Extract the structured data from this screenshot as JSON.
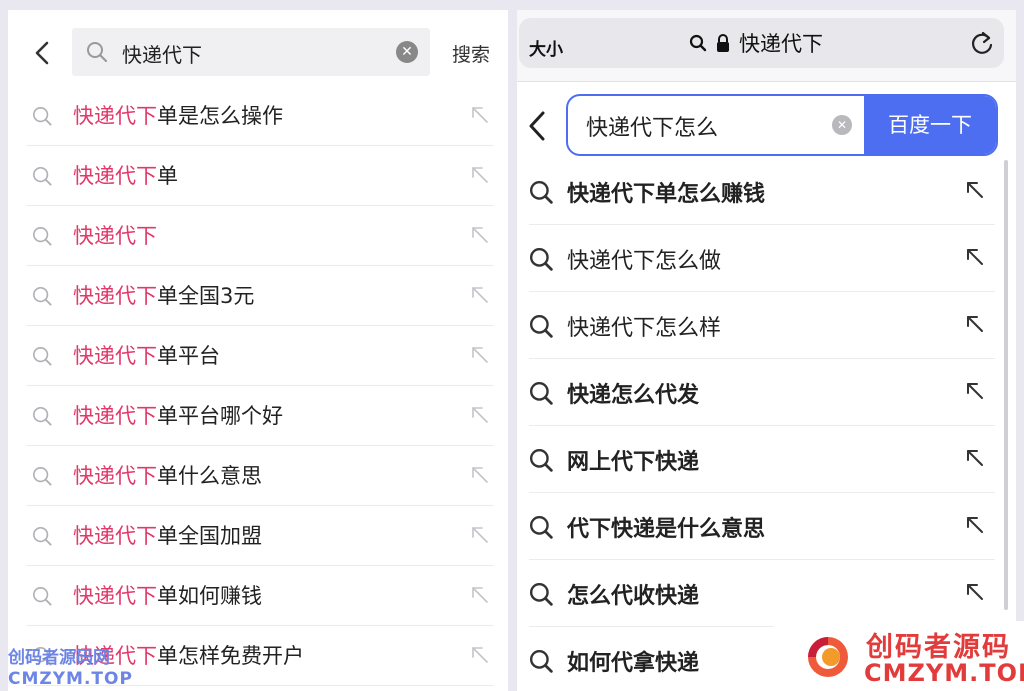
{
  "left": {
    "query": "快递代下",
    "search_button": "搜索",
    "suggestions": [
      {
        "hl": "快递代下",
        "rest": "单是怎么操作"
      },
      {
        "hl": "快递代下",
        "rest": "单"
      },
      {
        "hl": "快递代下",
        "rest": ""
      },
      {
        "hl": "快递代下",
        "rest": "单全国3元"
      },
      {
        "hl": "快递代下",
        "rest": "单平台"
      },
      {
        "hl": "快递代下",
        "rest": "单平台哪个好"
      },
      {
        "hl": "快递代下",
        "rest": "单什么意思"
      },
      {
        "hl": "快递代下",
        "rest": "单全国加盟"
      },
      {
        "hl": "快递代下",
        "rest": "单如何赚钱"
      },
      {
        "hl": "快递代下",
        "rest": "单怎样免费开户"
      }
    ],
    "highlight_color": "#e2386a"
  },
  "right": {
    "address_bar": {
      "text_size": "大小",
      "title": "快递代下"
    },
    "query": "快递代下怎么",
    "search_button": "百度一下",
    "suggestions": [
      "快递代下单怎么赚钱",
      "快递代下怎么做",
      "快递代下怎么样",
      "快递怎么代发",
      "网上代下快递",
      "代下快递是什么意思",
      "怎么代收快递",
      "如何代拿快递"
    ],
    "accent_color": "#4e6ef2"
  },
  "watermarks": {
    "left_line1": "创码者源码网",
    "left_line2": "CMZYM.TOP",
    "right_line1": "创码者源码",
    "right_line2": "CMZYM.TOP"
  }
}
